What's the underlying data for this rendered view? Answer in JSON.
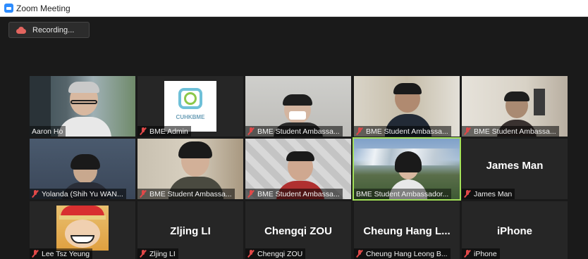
{
  "window": {
    "title": "Zoom Meeting"
  },
  "recording": {
    "label": "Recording..."
  },
  "participants": [
    {
      "name": "Aaron Ho",
      "muted": false
    },
    {
      "name": "BME Admin",
      "muted": true,
      "logo_text": "CUHKBME"
    },
    {
      "name": "BME Student Ambassa...",
      "muted": true
    },
    {
      "name": "BME Student Ambassa...",
      "muted": true
    },
    {
      "name": "BME Student Ambassa...",
      "muted": true
    },
    {
      "name": "Yolanda (Shih Yu WAN...",
      "muted": true
    },
    {
      "name": "BME Student Ambassa...",
      "muted": true
    },
    {
      "name": "BME Student Ambassa...",
      "muted": true
    },
    {
      "name": "BME Student Ambassador...",
      "muted": false,
      "active_speaker": true
    },
    {
      "name": "James Man",
      "muted": true,
      "display": "James Man"
    },
    {
      "name": "Lee Tsz Yeung",
      "muted": true
    },
    {
      "name": "Zljing LI",
      "muted": true,
      "display": "Zljing LI"
    },
    {
      "name": "Chengqi ZOU",
      "muted": true,
      "display": "Chengqi ZOU"
    },
    {
      "name": "Cheung Hang Leong B...",
      "muted": true,
      "display": "Cheung Hang L..."
    },
    {
      "name": "iPhone",
      "muted": true,
      "display": "iPhone"
    }
  ],
  "colors": {
    "active_border": "#a3e05a",
    "muted_mic": "#e04848",
    "tile_bg": "#262626"
  }
}
